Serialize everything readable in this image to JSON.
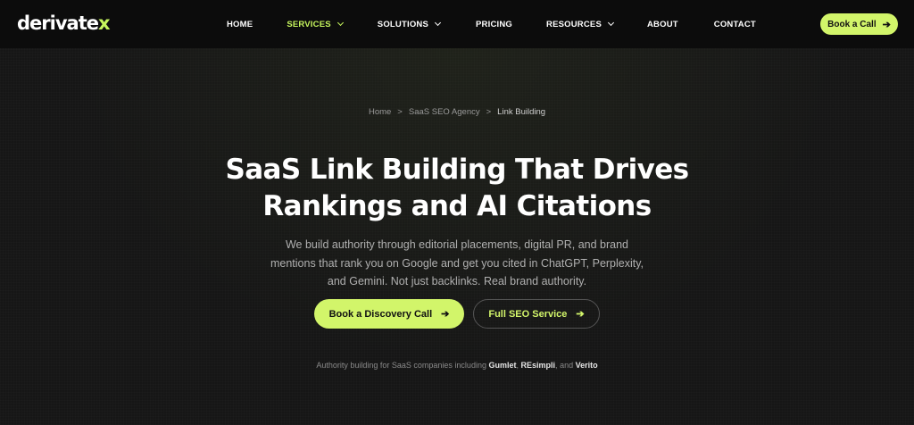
{
  "brand": {
    "logo_main": "derivate",
    "logo_accent": "x",
    "accent_color": "#c6f55d"
  },
  "nav": {
    "items": [
      {
        "label": "HOME",
        "dropdown": false,
        "active": false
      },
      {
        "label": "SERVICES",
        "dropdown": true,
        "active": true
      },
      {
        "label": "SOLUTIONS",
        "dropdown": true,
        "active": false
      },
      {
        "label": "PRICING",
        "dropdown": false,
        "active": false
      },
      {
        "label": "RESOURCES",
        "dropdown": true,
        "active": false
      },
      {
        "label": "ABOUT",
        "dropdown": false,
        "active": false
      },
      {
        "label": "CONTACT",
        "dropdown": false,
        "active": false
      }
    ],
    "cta_label": "Book a Call",
    "cta_icon": "arrow-right-icon"
  },
  "breadcrumb": {
    "items": [
      "Home",
      "SaaS SEO Agency",
      "Link Building"
    ],
    "separator": ">"
  },
  "hero": {
    "title_line1": "SaaS Link Building That Drives",
    "title_line2": "Rankings and AI Citations",
    "subtitle_line1": "We build authority through editorial placements, digital PR, and brand",
    "subtitle_line2": "mentions that rank you on Google and get you cited in ChatGPT, Perplexity,",
    "subtitle_line3": "and Gemini. Not just backlinks. Real brand authority.",
    "primary_cta": "Book a Discovery Call",
    "secondary_cta": "Full SEO Service"
  },
  "trust": {
    "prefix": "Authority building for SaaS companies including",
    "companies": [
      "Gumlet",
      "REsimpli",
      "Verito"
    ],
    "comma": ",",
    "and": "and"
  }
}
